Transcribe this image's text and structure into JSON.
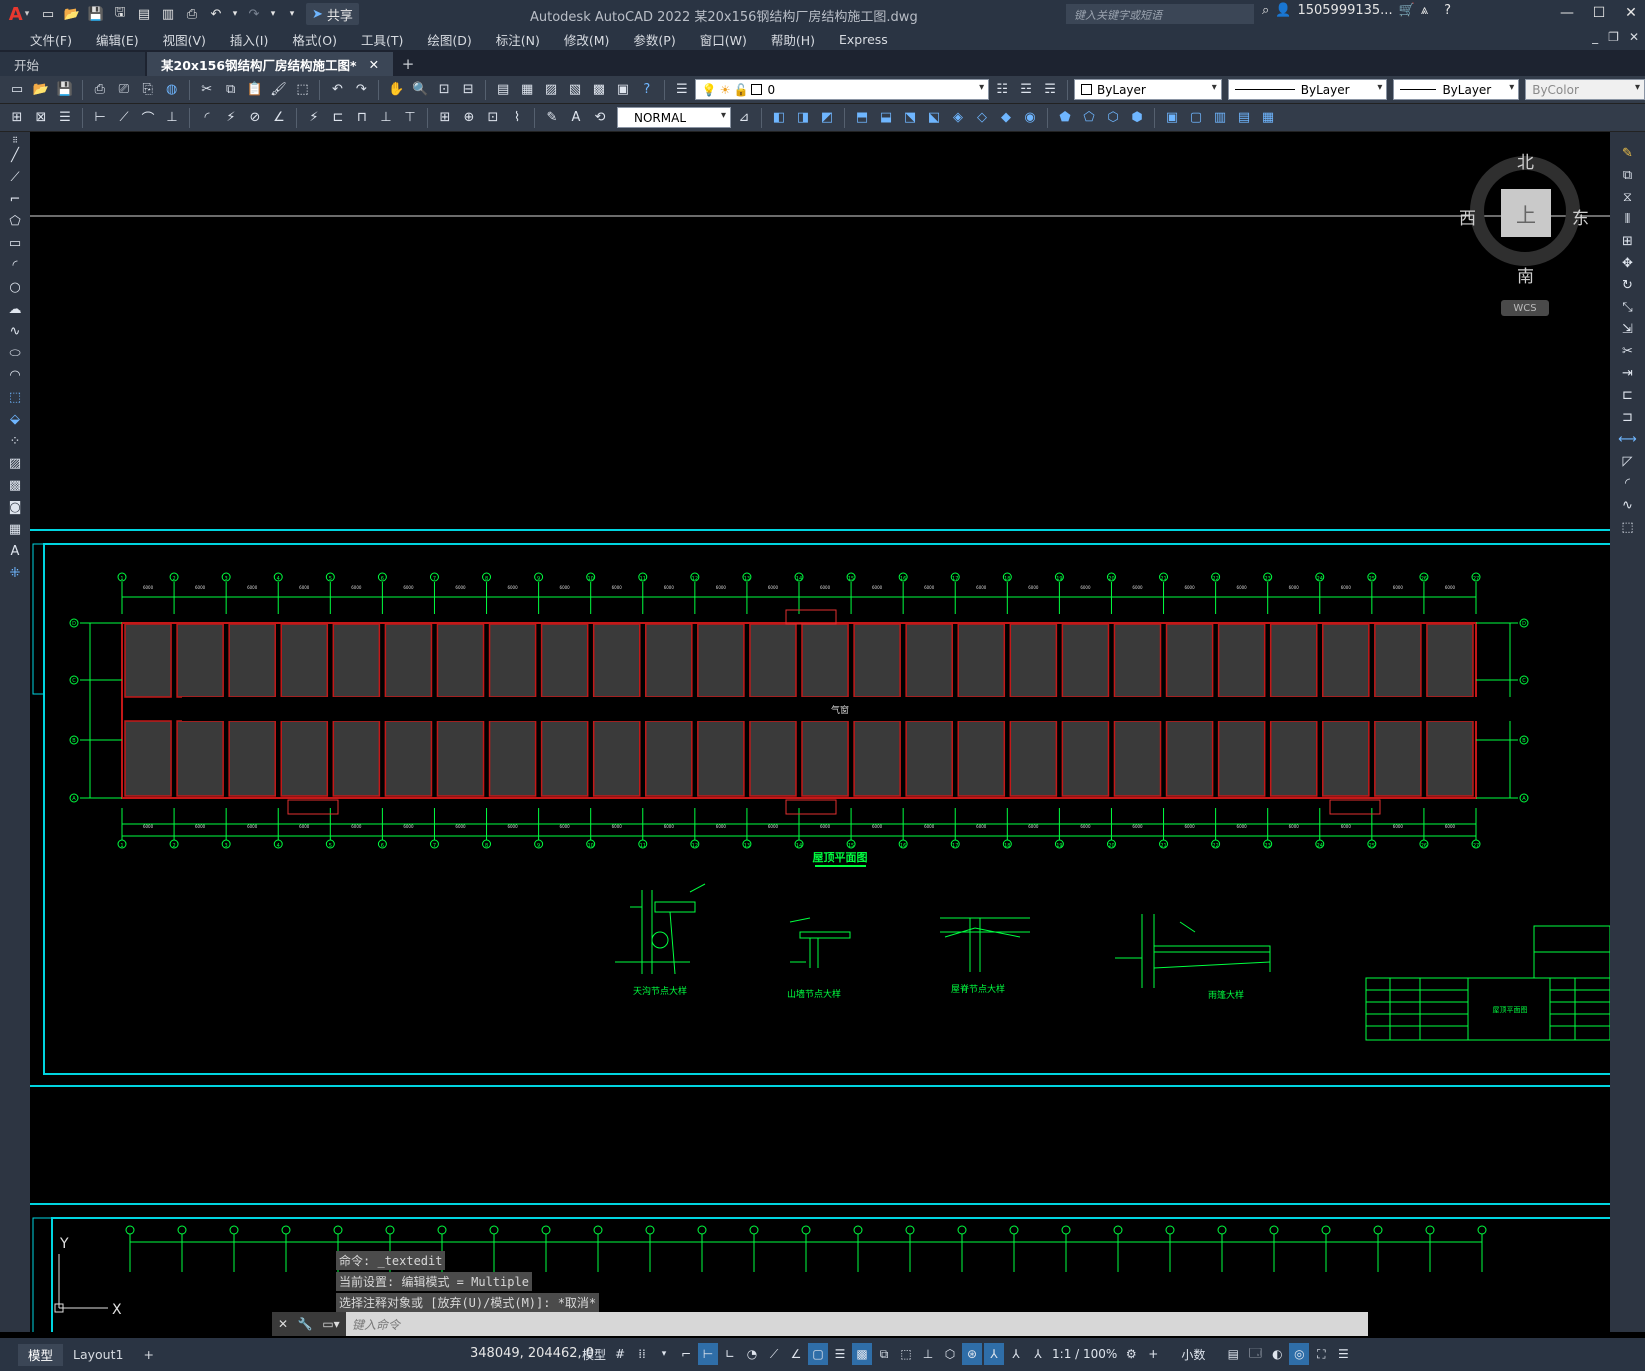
{
  "app": {
    "title": "Autodesk AutoCAD 2022    某20x156钢结构厂房结构施工图.dwg",
    "share_label": "共享",
    "search_placeholder": "键入关键字或短语",
    "user": "1505999135...",
    "logo": "A"
  },
  "menu": [
    "文件(F)",
    "编辑(E)",
    "视图(V)",
    "插入(I)",
    "格式(O)",
    "工具(T)",
    "绘图(D)",
    "标注(N)",
    "修改(M)",
    "参数(P)",
    "窗口(W)",
    "帮助(H)",
    "Express"
  ],
  "tabs": [
    {
      "label": "开始"
    },
    {
      "label": "某20x156钢结构厂房结构施工图*"
    }
  ],
  "properties": {
    "layer": "0",
    "color": "ByLayer",
    "linetype": "ByLayer",
    "lineweight": "ByLayer",
    "plotstyle": "ByColor",
    "dimstyle": "NORMAL"
  },
  "viewcube": {
    "north": "北",
    "south": "南",
    "east": "东",
    "west": "西",
    "face": "上",
    "wcs": "WCS"
  },
  "drawing": {
    "main_title": "屋顶平面图",
    "corridor_label": "气窗",
    "details": [
      {
        "label": "天沟节点大样"
      },
      {
        "label": "山墙节点大样"
      },
      {
        "label": "屋脊节点大样"
      },
      {
        "label": "雨篷大样"
      }
    ],
    "axes": [
      "1",
      "2",
      "3",
      "4",
      "5",
      "6",
      "7",
      "8",
      "9",
      "10",
      "11",
      "12",
      "13",
      "14",
      "15",
      "16",
      "17",
      "18",
      "19",
      "20",
      "21",
      "22",
      "23",
      "24",
      "25",
      "26",
      "27"
    ],
    "rows": [
      "D",
      "C",
      "B",
      "A"
    ],
    "span_label": "6000",
    "title_block_label": "屋顶平面图",
    "ucs_x": "X",
    "ucs_y": "Y"
  },
  "command_history": [
    "命令: _textedit",
    "当前设置: 编辑模式 = Multiple",
    "选择注释对象或 [放弃(U)/模式(M)]: *取消*"
  ],
  "command_prompt": "键入命令",
  "status": {
    "layout_tabs": [
      "模型",
      "Layout1"
    ],
    "coords": "348049, 204462, 0",
    "model_label": "模型",
    "scale": "1:1 / 100%",
    "units": "小数"
  }
}
